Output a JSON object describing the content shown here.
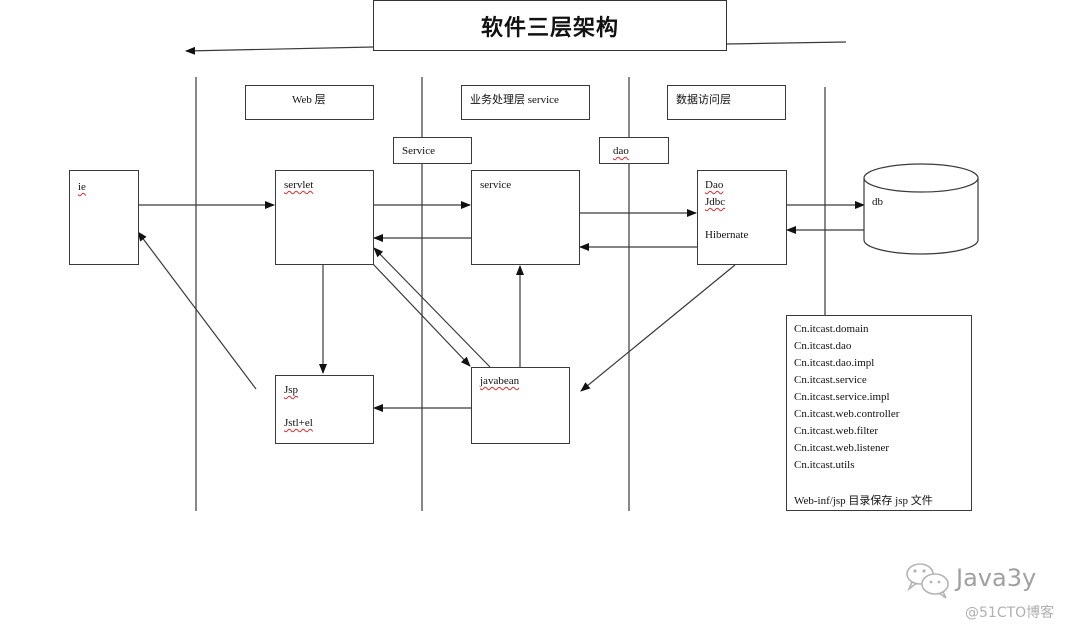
{
  "title": "软件三层架构",
  "layers": {
    "web": "Web 层",
    "service": "业务处理层  service",
    "dao": "数据访问层"
  },
  "package_labels": {
    "service": "Service",
    "dao": "dao"
  },
  "nodes": {
    "ie": "ie",
    "servlet": "servlet",
    "service": "service",
    "dao": [
      "Dao",
      "Jdbc",
      "Hibernate"
    ],
    "db": "db",
    "jsp": [
      "Jsp",
      "Jstl+el"
    ],
    "javabean": "javabean"
  },
  "packages": [
    "Cn.itcast.domain",
    "Cn.itcast.dao",
    "Cn.itcast.dao.impl",
    "Cn.itcast.service",
    "Cn.itcast.service.impl",
    "Cn.itcast.web.controller",
    "Cn.itcast.web.filter",
    "Cn.itcast.web.listener",
    "Cn.itcast.utils"
  ],
  "package_note": "Web-inf/jsp 目录保存 jsp 文件",
  "watermark": {
    "brand": "Java3y",
    "source": "@51CTO博客",
    "icon": "wechat-icon"
  },
  "edges": [
    {
      "from": "ie",
      "to": "servlet"
    },
    {
      "from": "servlet",
      "to": "service"
    },
    {
      "from": "service",
      "to": "servlet"
    },
    {
      "from": "service",
      "to": "dao"
    },
    {
      "from": "dao",
      "to": "service"
    },
    {
      "from": "dao",
      "to": "db"
    },
    {
      "from": "db",
      "to": "dao"
    },
    {
      "from": "servlet",
      "to": "jsp"
    },
    {
      "from": "servlet",
      "to": "javabean"
    },
    {
      "from": "javabean",
      "to": "servlet"
    },
    {
      "from": "javabean",
      "to": "service"
    },
    {
      "from": "javabean",
      "to": "jsp"
    },
    {
      "from": "dao",
      "to": "javabean"
    },
    {
      "from": "jsp",
      "to": "ie"
    }
  ]
}
